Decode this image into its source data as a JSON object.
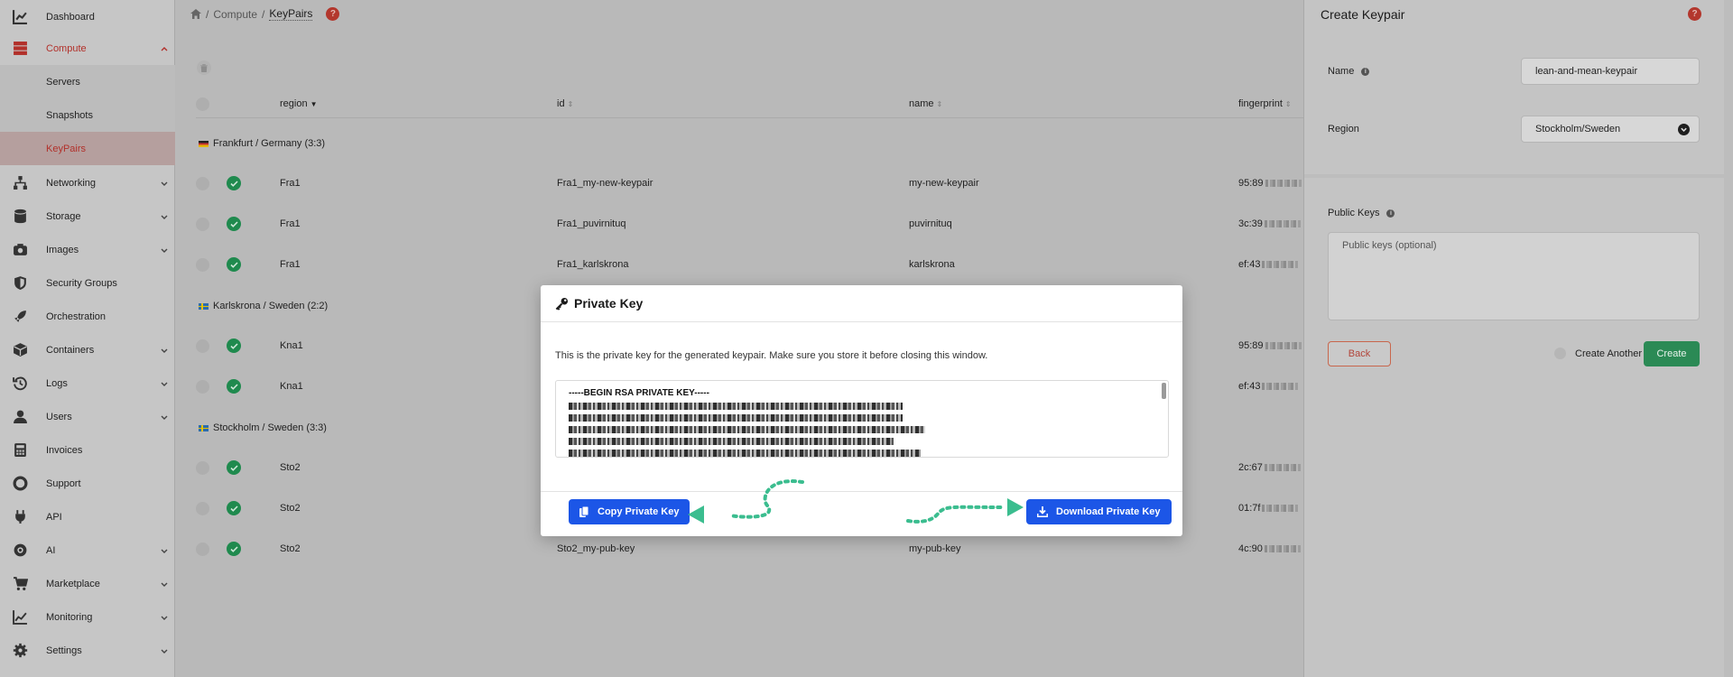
{
  "sidebar": {
    "items": [
      {
        "label": "Dashboard",
        "icon": "chart-line-icon"
      },
      {
        "label": "Compute",
        "icon": "server-stack-icon"
      },
      {
        "label": "Networking",
        "icon": "network-icon"
      },
      {
        "label": "Storage",
        "icon": "database-icon"
      },
      {
        "label": "Images",
        "icon": "camera-icon"
      },
      {
        "label": "Security Groups",
        "icon": "shield-icon"
      },
      {
        "label": "Orchestration",
        "icon": "rocket-icon"
      },
      {
        "label": "Containers",
        "icon": "cube-icon"
      },
      {
        "label": "Logs",
        "icon": "history-icon"
      },
      {
        "label": "Users",
        "icon": "user-icon"
      },
      {
        "label": "Invoices",
        "icon": "calculator-icon"
      },
      {
        "label": "Support",
        "icon": "lifebuoy-icon"
      },
      {
        "label": "API",
        "icon": "plug-icon"
      },
      {
        "label": "AI",
        "icon": "brain-icon"
      },
      {
        "label": "Marketplace",
        "icon": "cart-icon"
      },
      {
        "label": "Monitoring",
        "icon": "chart-area-icon"
      },
      {
        "label": "Settings",
        "icon": "gear-icon"
      }
    ],
    "compute_sub": [
      "Servers",
      "Snapshots",
      "KeyPairs"
    ]
  },
  "breadcrumb": {
    "sep": "/",
    "parent": "Compute",
    "current": "KeyPairs",
    "help": "?"
  },
  "table": {
    "headers": {
      "region": "region",
      "id": "id",
      "name": "name",
      "fingerprint": "fingerprint"
    },
    "groups": [
      {
        "label": "Frankfurt / Germany (3:3)",
        "rows": [
          {
            "region": "Fra1",
            "id": "Fra1_my-new-keypair",
            "name": "my-new-keypair",
            "fp": "95:89"
          },
          {
            "region": "Fra1",
            "id": "Fra1_puvirnituq",
            "name": "puvirnituq",
            "fp": "3c:39"
          },
          {
            "region": "Fra1",
            "id": "Fra1_karlskrona",
            "name": "karlskrona",
            "fp": "ef:43"
          }
        ]
      },
      {
        "label": "Karlskrona / Sweden (2:2)",
        "rows": [
          {
            "region": "Kna1",
            "id": "",
            "name": "",
            "fp": "95:89"
          },
          {
            "region": "Kna1",
            "id": "",
            "name": "",
            "fp": "ef:43"
          }
        ]
      },
      {
        "label": "Stockholm / Sweden (3:3)",
        "rows": [
          {
            "region": "Sto2",
            "id": "",
            "name": "",
            "fp": "2c:67"
          },
          {
            "region": "Sto2",
            "id": "",
            "name": "",
            "fp": "01:7f"
          },
          {
            "region": "Sto2",
            "id": "Sto2_my-pub-key",
            "name": "my-pub-key",
            "fp": "4c:90"
          }
        ]
      }
    ]
  },
  "panel": {
    "title": "Create Keypair",
    "help": "?",
    "name_label": "Name",
    "name_value": "lean-and-mean-keypair",
    "region_label": "Region",
    "region_value": "Stockholm/Sweden",
    "public_keys_label": "Public Keys",
    "public_keys_placeholder": "Public keys (optional)",
    "back": "Back",
    "create_another": "Create Another",
    "create": "Create",
    "info": "i"
  },
  "modal": {
    "title": "Private Key",
    "description": "This is the private key for the generated keypair. Make sure you store it before closing this window.",
    "key_header": "-----BEGIN RSA PRIVATE KEY-----",
    "copy": "Copy Private Key",
    "download": "Download Private Key"
  },
  "colors": {
    "accent_red": "#b2302a",
    "primary_blue": "#1c56e7",
    "success_green": "#2b8a55",
    "arrow_teal": "#3bbd8f"
  }
}
